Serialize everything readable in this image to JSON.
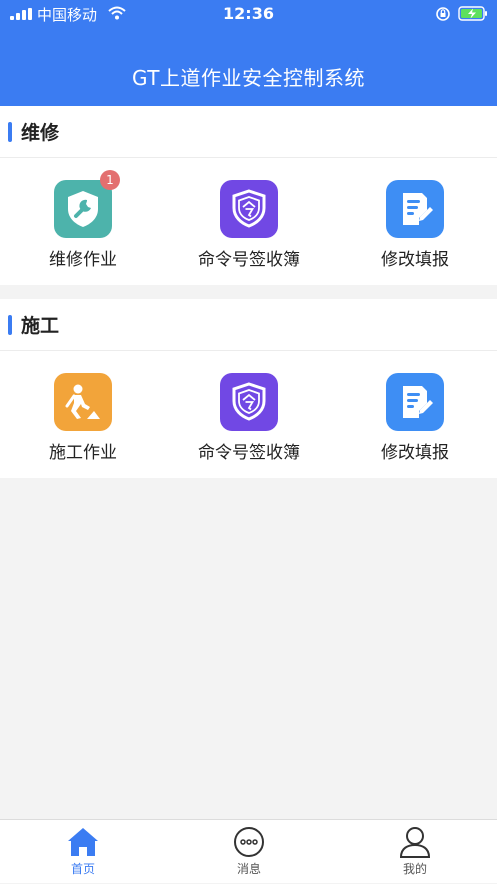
{
  "status_bar": {
    "carrier": "中国移动",
    "time": "12:36"
  },
  "header": {
    "title": "GT上道作业安全控制系统"
  },
  "sections": [
    {
      "title": "维修",
      "items": [
        {
          "label": "维修作业",
          "icon": "wrench-shield-icon",
          "badge": "1",
          "color": "#4db3ab"
        },
        {
          "label": "命令号签收簿",
          "icon": "command-shield-icon",
          "color": "#7148e4"
        },
        {
          "label": "修改填报",
          "icon": "edit-document-icon",
          "color": "#3e8ef4"
        }
      ]
    },
    {
      "title": "施工",
      "items": [
        {
          "label": "施工作业",
          "icon": "construction-worker-icon",
          "color": "#f2a43a"
        },
        {
          "label": "命令号签收簿",
          "icon": "command-shield-icon",
          "color": "#7148e4"
        },
        {
          "label": "修改填报",
          "icon": "edit-document-icon",
          "color": "#3e8ef4"
        }
      ]
    }
  ],
  "tabbar": {
    "items": [
      {
        "label": "首页",
        "icon": "home-icon",
        "active": true
      },
      {
        "label": "消息",
        "icon": "message-icon",
        "active": false
      },
      {
        "label": "我的",
        "icon": "profile-icon",
        "active": false
      }
    ]
  },
  "colors": {
    "primary": "#3b7cf2",
    "badge": "#e36f6f",
    "background": "#f3f3f3"
  }
}
